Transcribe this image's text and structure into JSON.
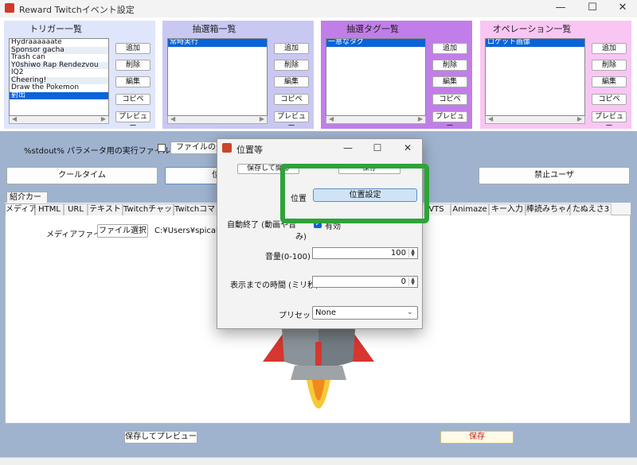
{
  "window": {
    "title": "Reward Twitchイベント設定",
    "controls": [
      "—",
      "☐",
      "✕"
    ]
  },
  "panels": {
    "trigger": {
      "title": "トリガー一覧",
      "items": [
        "Hydraaaaaate",
        "Sponsor gacha",
        "Trash can",
        "Y0shiwo Rap Rendezvou",
        "IQ2",
        "Cheering!",
        "Draw the Pokemon",
        "射出"
      ],
      "selected_index": 7
    },
    "lottery_box": {
      "title": "抽選箱一覧",
      "items": [
        "常時実行"
      ],
      "selected_index": 0
    },
    "lottery_tag": {
      "title": "抽選タグ一覧",
      "items": [
        "一意なタグ"
      ],
      "selected_index": 0
    },
    "operation": {
      "title": "オペレーション一覧",
      "items": [
        "ロケット画像"
      ],
      "selected_index": 0
    },
    "buttons": {
      "add": "追加",
      "delete": "削除",
      "edit": "編集",
      "copy": "コピペ",
      "preview": "プレビュー"
    },
    "colors": {
      "trigger": "#dfe5fb",
      "lottery_box": "#c8c8f3",
      "lottery_tag": "#c17ee8",
      "operation": "#f9c6f3"
    }
  },
  "main": {
    "stdout_label": "%stdout% パラメータ用の実行ファイルを使う",
    "file_select_label": "ファイルの選",
    "cooltime_button": "クールタイム",
    "position_button_partial": "位",
    "banned_users_button": "禁止ユーザ",
    "card_tab": "紹介カード",
    "tabs": [
      "メディア",
      "HTML",
      "URL",
      "テキスト",
      "Twitchチャット",
      "Twitchコマン",
      "VTS",
      "Animaze",
      "キー入力",
      "棒読みちゃん",
      "たぬえさ3"
    ],
    "active_tab_index": 0,
    "media_file_label": "メディアファイル",
    "media_file_button": "ファイル選択",
    "media_path": "C:¥Users¥spica¥P",
    "save_preview_button": "保存してプレビュー",
    "save_button": "保存"
  },
  "dialog": {
    "title": "位置等",
    "controls": [
      "—",
      "☐",
      "✕"
    ],
    "save_open_button": "保存して開",
    "save_open_suffix": "る",
    "save_button": "保存",
    "position_label": "位置",
    "position_button": "位置設定",
    "auto_end_label": "自動終了 (動画や音",
    "auto_end_suffix": "み)",
    "auto_end_checked_label": "有効",
    "volume_label": "音量(0-100)",
    "volume_value": "100",
    "delay_label": "表示までの時間 (ミリ秒)",
    "delay_value": "0",
    "preset_label": "プリセット",
    "preset_value": "None",
    "highlight_color": "#2ea338"
  },
  "icons": {
    "app": "rocket-app-icon",
    "dialog": "rocket-app-icon",
    "checkbox_checked": "✓",
    "chevron_down": "⌄",
    "spin_up": "▲",
    "spin_down": "▼",
    "scroll_left": "◀",
    "scroll_right": "▶"
  }
}
